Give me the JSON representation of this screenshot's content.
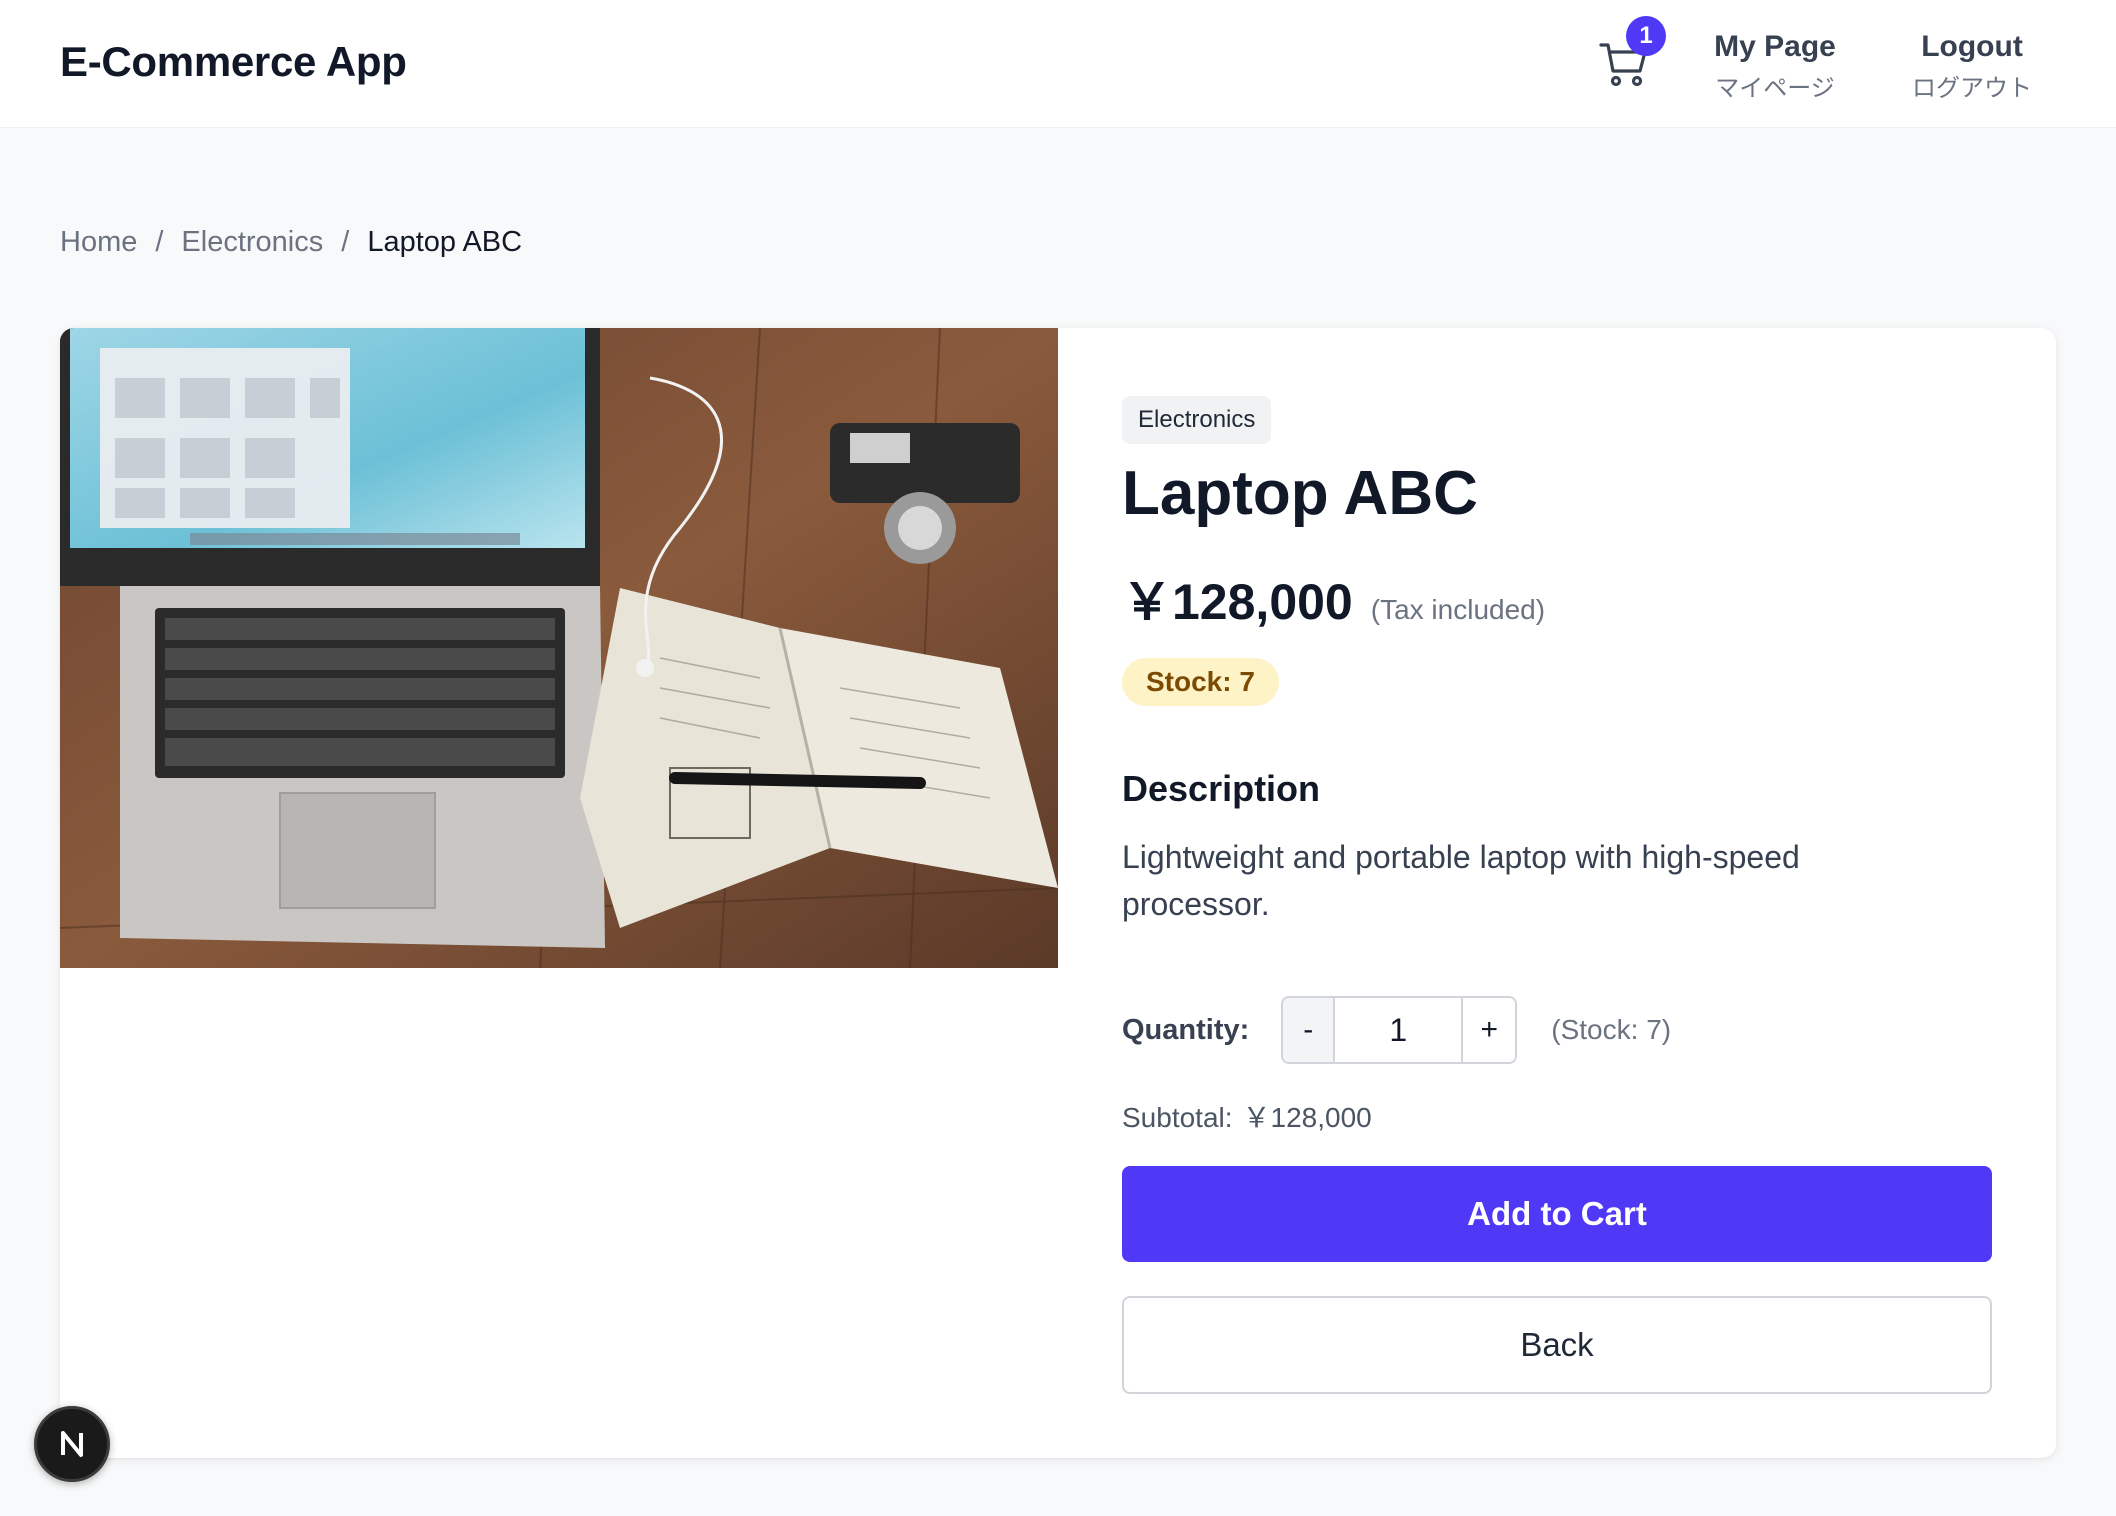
{
  "header": {
    "app_title": "E-Commerce App",
    "cart_count": "1",
    "mypage_label": "My Page",
    "mypage_sub": "マイページ",
    "logout_label": "Logout",
    "logout_sub": "ログアウト"
  },
  "breadcrumb": {
    "items": [
      "Home",
      "Electronics",
      "Laptop ABC"
    ],
    "separator": "/"
  },
  "product": {
    "category": "Electronics",
    "name": "Laptop ABC",
    "price": "￥128,000",
    "tax_note": "(Tax included)",
    "stock_badge": "Stock: 7",
    "description_heading": "Description",
    "description": "Lightweight and portable laptop with high-speed processor."
  },
  "purchase": {
    "quantity_label": "Quantity:",
    "minus_label": "-",
    "plus_label": "+",
    "quantity_value": "1",
    "stock_note": "(Stock: 7)",
    "subtotal_label": "Subtotal:",
    "subtotal_value": "￥128,000",
    "add_to_cart_label": "Add to Cart",
    "back_label": "Back"
  },
  "dev_badge": {
    "letter": "N"
  },
  "colors": {
    "accent": "#4f39f6",
    "stock_bg": "#fef3c7",
    "stock_text": "#7c4a03",
    "page_bg": "#f8f9fa"
  },
  "icons": [
    "cart-icon",
    "nextjs-icon"
  ]
}
